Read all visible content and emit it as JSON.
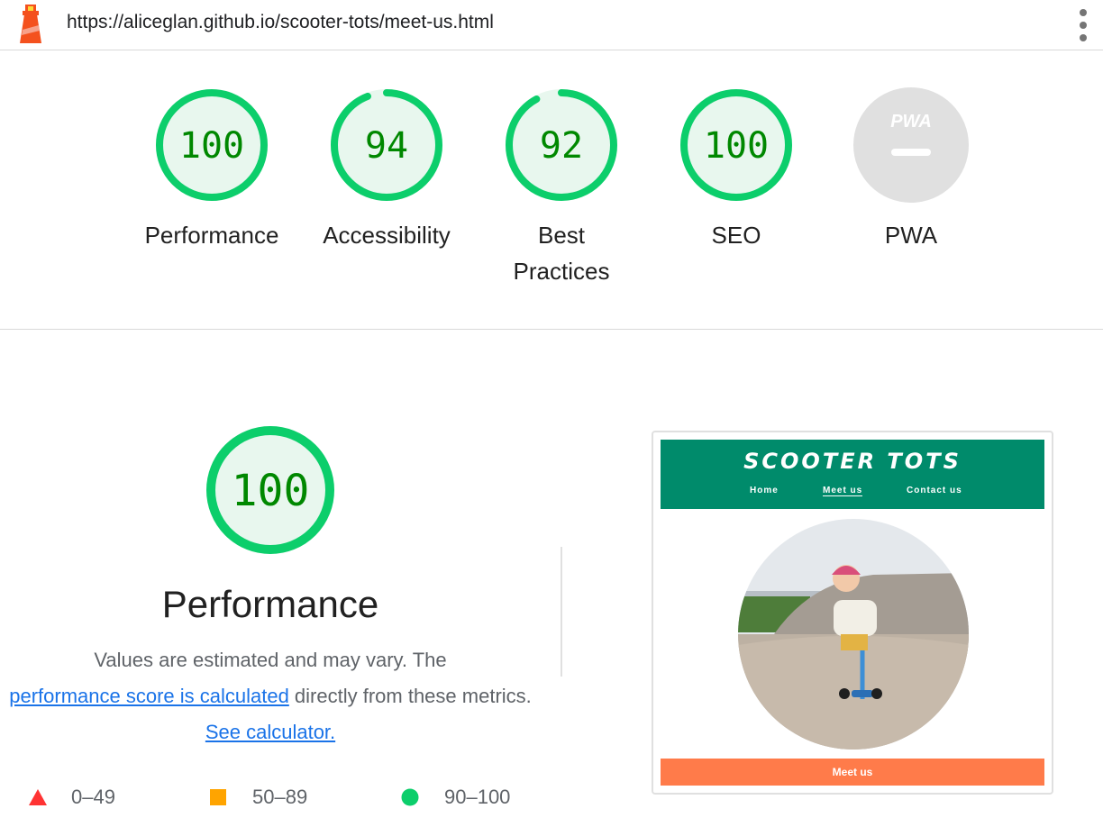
{
  "report": {
    "url": "https://aliceglan.github.io/scooter-tots/meet-us.html"
  },
  "colors": {
    "pass": "#0cce6b",
    "pass_text": "#008800",
    "pass_fill": "#e8f7ee",
    "average": "#ffa400",
    "fail": "#ff3333",
    "na": "#e0e0e0",
    "link": "#1a73e8"
  },
  "gauges": [
    {
      "label": "Performance",
      "score": "100",
      "value": 100
    },
    {
      "label": "Accessibility",
      "score": "94",
      "value": 94
    },
    {
      "label": "Best Practices",
      "score": "92",
      "value": 92
    },
    {
      "label": "SEO",
      "score": "100",
      "value": 100
    },
    {
      "label": "PWA",
      "badge_text": "PWA"
    }
  ],
  "performance": {
    "score": "100",
    "value": 100,
    "title": "Performance",
    "desc_part1": "Values are estimated and may vary. The ",
    "desc_link1": "performance score is calculated",
    "desc_part2": " directly from these metrics. ",
    "desc_link2": "See calculator.",
    "legend": [
      {
        "range": "0–49",
        "icon": "red-triangle-icon"
      },
      {
        "range": "50–89",
        "icon": "orange-square-icon"
      },
      {
        "range": "90–100",
        "icon": "green-circle-icon"
      }
    ]
  },
  "screenshot": {
    "site_title": "SCOOTER TOTS",
    "nav": [
      "Home",
      "Meet us",
      "Contact us"
    ],
    "nav_active": "Meet us",
    "cta_label": "Meet us",
    "header_color": "#008b6b",
    "cta_color": "#ff7b4a"
  }
}
